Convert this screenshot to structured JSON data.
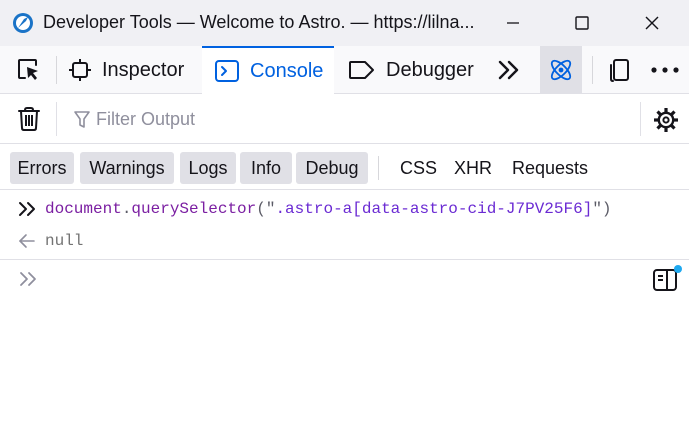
{
  "window": {
    "title": "Developer Tools — Welcome to Astro. — https://lilna..."
  },
  "toolbar": {
    "tabs": [
      {
        "label": "Inspector"
      },
      {
        "label": "Console"
      },
      {
        "label": "Debugger"
      }
    ],
    "active_tab": "Console",
    "accent_color": "#0061e0"
  },
  "filter": {
    "placeholder": "Filter Output",
    "value": ""
  },
  "levels": {
    "errors": "Errors",
    "warnings": "Warnings",
    "logs": "Logs",
    "info": "Info",
    "debug": "Debug"
  },
  "network_filters": {
    "css": "CSS",
    "xhr": "XHR",
    "requests": "Requests"
  },
  "console": {
    "input": {
      "object": "document",
      "dot": ".",
      "method": "querySelector",
      "open": "(\"",
      "argument": ".astro-a[data-astro-cid-J7PV25F6]",
      "close": "\")"
    },
    "result": "null"
  },
  "icons": {
    "app": "firefox-devtools-icon",
    "picker": "element-picker-icon",
    "inspector": "inspector-icon",
    "console": "console-icon",
    "debugger": "debugger-icon",
    "more": "chevron-double-right-icon",
    "astro": "astro-atom-icon",
    "dock": "dock-side-icon",
    "menu": "more-horizontal-icon",
    "trash": "trash-icon",
    "filter": "filter-funnel-icon",
    "settings": "gear-icon",
    "editor": "editor-mode-icon"
  }
}
